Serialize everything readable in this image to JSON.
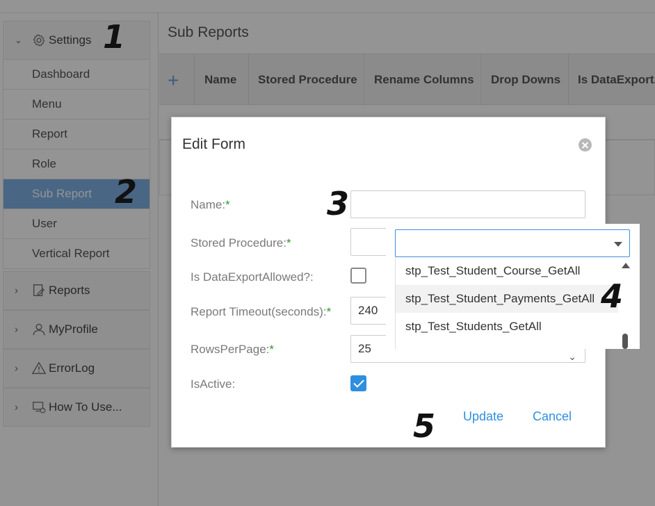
{
  "sidebar": {
    "settings_label": "Settings",
    "items": [
      {
        "label": "Dashboard"
      },
      {
        "label": "Menu"
      },
      {
        "label": "Report"
      },
      {
        "label": "Role"
      },
      {
        "label": "Sub Report"
      },
      {
        "label": "User"
      },
      {
        "label": "Vertical Report"
      }
    ],
    "groups": [
      {
        "label": "Reports",
        "icon": "report-edit-icon"
      },
      {
        "label": "MyProfile",
        "icon": "user-icon"
      },
      {
        "label": "ErrorLog",
        "icon": "warning-icon"
      },
      {
        "label": "How To Use...",
        "icon": "help-screen-icon"
      }
    ],
    "active_item": "Sub Report"
  },
  "main": {
    "page_title": "Sub Reports",
    "columns": [
      "Name",
      "Stored Procedure",
      "Rename Columns",
      "Drop Downs",
      "Is DataExportA"
    ]
  },
  "dialog": {
    "title": "Edit Form",
    "fields": {
      "name_label": "Name:",
      "name_value": "",
      "stored_procedure_label": "Stored Procedure:",
      "stored_procedure_value": "",
      "is_export_label": "Is DataExportAllowed?:",
      "is_export_checked": false,
      "timeout_label": "Report Timeout(seconds):",
      "timeout_value": "240",
      "rows_label": "RowsPerPage:",
      "rows_value": "25",
      "is_active_label": "IsActive:",
      "is_active_checked": true
    },
    "required_mark": "*",
    "update_label": "Update",
    "cancel_label": "Cancel"
  },
  "dropdown": {
    "options": [
      "stp_Test_Student_Course_GetAll",
      "stp_Test_Student_Payments_GetAll",
      "stp_Test_Students_GetAll"
    ],
    "hovered_index": 1
  },
  "annotations": [
    "1",
    "2",
    "3",
    "4",
    "5"
  ],
  "colors": {
    "accent": "#2e8fe0",
    "active_sidebar": "#7fb1e6",
    "required": "#2a9a2a"
  }
}
